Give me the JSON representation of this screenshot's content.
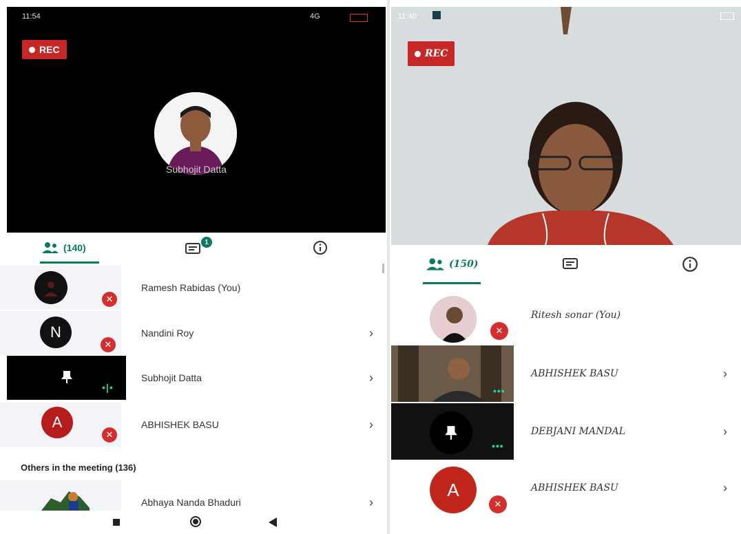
{
  "left": {
    "status_time": "11:54",
    "status_network": "4G",
    "rec_label": "REC",
    "speaker_name": "Subhojit Datta",
    "tab_participants_count": "(140)",
    "tab_chat_badge": "1",
    "participants": [
      {
        "name": "Ramesh Rabidas (You)"
      },
      {
        "name": "Nandini Roy",
        "initial": "N"
      },
      {
        "name": "Subhojit Datta"
      },
      {
        "name": "ABHISHEK BASU",
        "initial": "A"
      }
    ],
    "others_heading": "Others in the meeting (136)",
    "others": [
      {
        "name": "Abhaya Nanda Bhaduri"
      }
    ]
  },
  "right": {
    "status_time": "11:40",
    "rec_label": "REC",
    "tab_participants_count": "(150)",
    "participants": [
      {
        "name": "Ritesh sonar (You)"
      },
      {
        "name": "ABHISHEK BASU"
      },
      {
        "name": "DEBJANI MANDAL"
      },
      {
        "name": "ABHISHEK BASU",
        "initial": "A"
      }
    ]
  },
  "colors": {
    "accent": "#0b7a5e",
    "rec": "#c62828",
    "mute": "#d32f2f",
    "avatar_red": "#b71c1c"
  }
}
